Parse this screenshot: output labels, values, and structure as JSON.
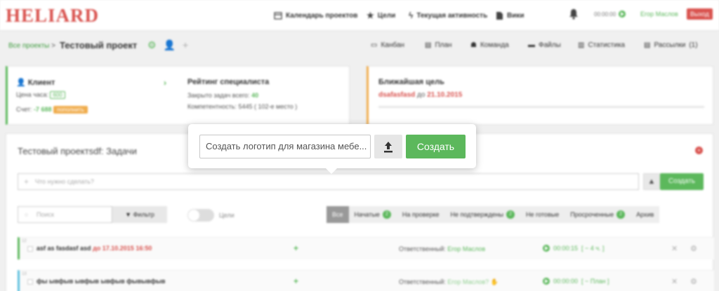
{
  "header": {
    "logo": "HELIARD",
    "nav": [
      {
        "label": "Календарь проектов",
        "icon": "calendar-icon"
      },
      {
        "label": "Цели",
        "icon": "star-icon"
      },
      {
        "label": "Текущая активность",
        "icon": "bolt-icon"
      },
      {
        "label": "Вики",
        "icon": "document-icon"
      }
    ],
    "timer": "00:00:00",
    "user": "Егор Маслов",
    "logout": "Выход"
  },
  "project": {
    "breadcrumb": "Все проекты",
    "separator": ">",
    "title": "Тестовый проект",
    "tabs": [
      {
        "label": "Канбан",
        "icon": "monitor-icon"
      },
      {
        "label": "План",
        "icon": "list-icon"
      },
      {
        "label": "Команда",
        "icon": "team-icon"
      },
      {
        "label": "Файлы",
        "icon": "folder-icon"
      },
      {
        "label": "Статистика",
        "icon": "chart-icon"
      },
      {
        "label": "Рассылки",
        "icon": "mail-icon",
        "count": "(1)"
      }
    ]
  },
  "client_card": {
    "title": "Клиент",
    "price_label": "Цена часа:",
    "price_value": "600",
    "account_label": "Счет:",
    "account_value": "-7 688",
    "topup_label": "пополнить",
    "rating_title": "Рейтинг специалиста",
    "closed_label": "Закрыто задач всего:",
    "closed_value": "40",
    "competence_label": "Компетентность:",
    "competence_value": "5445",
    "competence_place": "( 102-е место )"
  },
  "goal_card": {
    "title": "Ближайшая цель",
    "goal_name": "dsafasfasd",
    "goal_due_prefix": "до",
    "goal_due": "21.10.2015"
  },
  "tasks": {
    "title": "Тестовый проектsdf: Задачи",
    "new_task_placeholder": "Что нужно сделать?",
    "create_label": "Создать",
    "search_placeholder": "Поиск",
    "filter_label": "Фильтр",
    "goals_toggle_label": "Цели",
    "filters": [
      {
        "label": "Все",
        "active": true
      },
      {
        "label": "Начатые",
        "count": "2"
      },
      {
        "label": "На проверке"
      },
      {
        "label": "Не подтверждены",
        "count": "2"
      },
      {
        "label": "Не готовые"
      },
      {
        "label": "Просроченные",
        "count": "2"
      },
      {
        "label": "Архив"
      }
    ],
    "rows": [
      {
        "num": "12",
        "text": "asf as fasdasf asd",
        "due": "до 17.10.2015 16:50",
        "resp_label": "Ответственный:",
        "resp_name": "Егор Маслов",
        "time": "00:00:15",
        "plan": "[ ~ 4 ч. ]"
      },
      {
        "num": "13",
        "text": "фы ывфыв ывфыв ывфыв фывывфыв",
        "due": "",
        "resp_label": "Ответственный:",
        "resp_name": "Егор Маслов?",
        "time": "00:00:00",
        "plan": "[ ~ План ]"
      }
    ]
  },
  "popup": {
    "input_value": "Создать логотип для магазина мебе...",
    "create_label": "Создать"
  }
}
